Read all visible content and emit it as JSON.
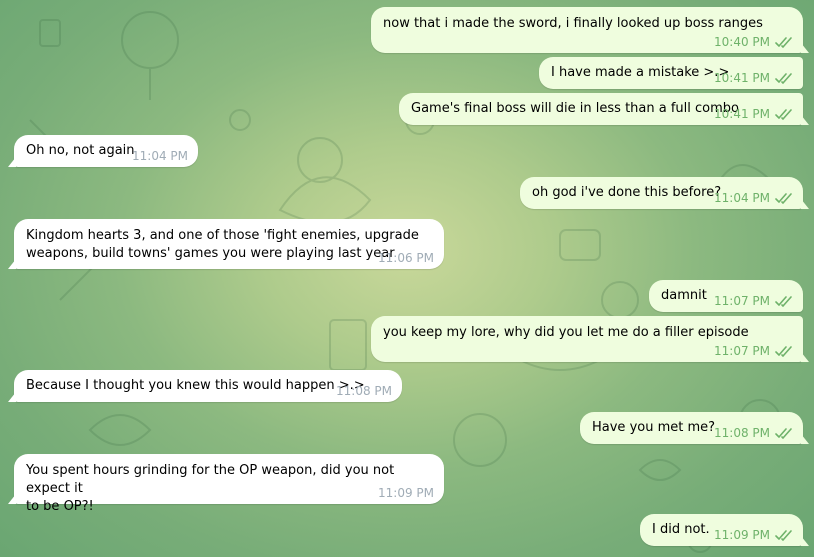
{
  "colors": {
    "incoming_bubble": "#ffffff",
    "outgoing_bubble": "#effdde",
    "incoming_time": "#a0acb6",
    "outgoing_time": "#6fb26a",
    "wallpaper_center": "#c9d89a",
    "wallpaper_edge": "#6aa672"
  },
  "messages": [
    {
      "direction": "out",
      "text": "now that i made the sword, i finally looked up boss ranges",
      "time": "10:40 PM",
      "status_icon": "double-check-icon"
    },
    {
      "direction": "out",
      "text": "I have made a mistake >.>",
      "time": "10:41 PM",
      "status_icon": "double-check-icon"
    },
    {
      "direction": "out",
      "text": "Game's final boss will die in less than a full combo",
      "time": "10:41 PM",
      "status_icon": "double-check-icon"
    },
    {
      "direction": "in",
      "text": "Oh no, not again",
      "time": "11:04 PM"
    },
    {
      "direction": "out",
      "text": "oh god i've done this before?",
      "time": "11:04 PM",
      "status_icon": "double-check-icon"
    },
    {
      "direction": "in",
      "text": "Kingdom hearts 3, and one of those 'fight enemies, upgrade\nweapons, build towns' games you were playing last year",
      "time": "11:06 PM"
    },
    {
      "direction": "out",
      "text": "damnit",
      "time": "11:07 PM",
      "status_icon": "double-check-icon"
    },
    {
      "direction": "out",
      "text": "you keep my lore, why did you let me do a filler episode",
      "time": "11:07 PM",
      "status_icon": "double-check-icon"
    },
    {
      "direction": "in",
      "text": "Because I thought you knew this would happen >.>",
      "time": "11:08 PM"
    },
    {
      "direction": "out",
      "text": "Have you met me?",
      "time": "11:08 PM",
      "status_icon": "double-check-icon"
    },
    {
      "direction": "in",
      "text": "You spent hours grinding for the OP weapon, did you not expect it\nto be OP?!",
      "time": "11:09 PM"
    },
    {
      "direction": "out",
      "text": "I did not.",
      "time": "11:09 PM",
      "status_icon": "double-check-icon"
    }
  ]
}
